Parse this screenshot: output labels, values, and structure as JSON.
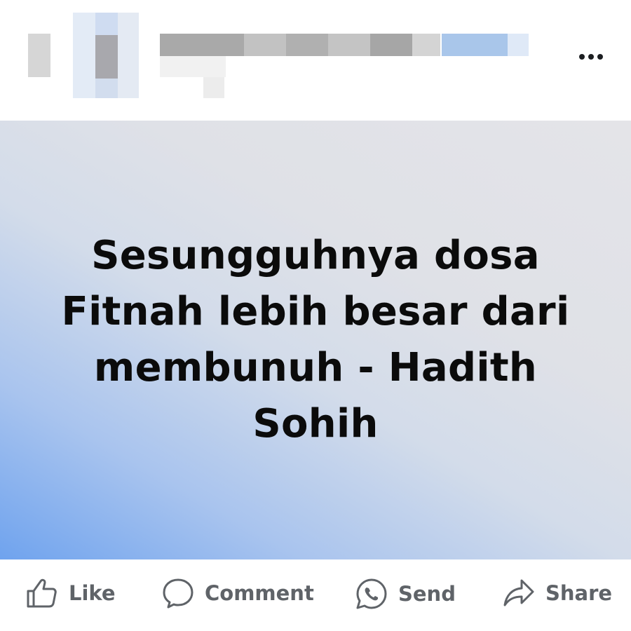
{
  "post": {
    "author_redacted": true,
    "more_options_icon": "more-horizontal-icon",
    "background_text": "Sesungguhnya dosa Fitnah lebih besar dari membunuh - Hadith Sohih",
    "background_colors": {
      "gradient_start": "#6fa3ee",
      "gradient_end": "#e4e4e8"
    }
  },
  "actions": [
    {
      "icon": "thumbs-up-icon",
      "label": "Like"
    },
    {
      "icon": "comment-bubble-icon",
      "label": "Comment"
    },
    {
      "icon": "whatsapp-icon",
      "label": "Send"
    },
    {
      "icon": "share-arrow-icon",
      "label": "Share"
    }
  ],
  "colors": {
    "text_dark": "#0b0b0b",
    "action_text": "#5f6368"
  }
}
